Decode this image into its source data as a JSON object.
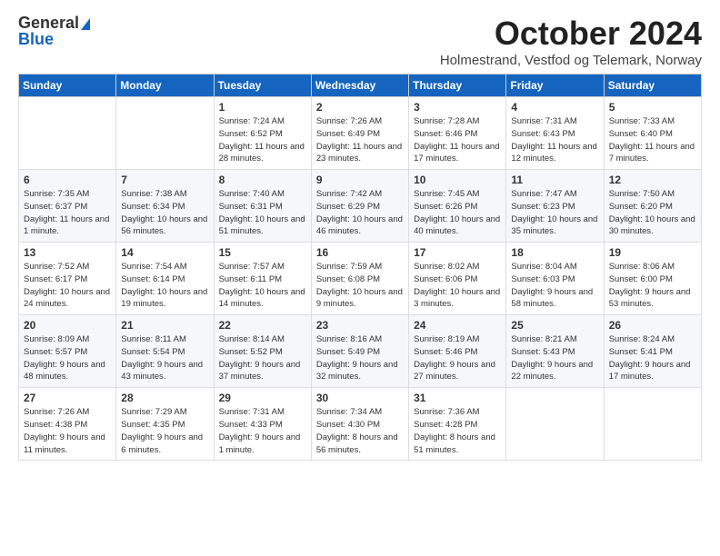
{
  "header": {
    "logo_line1": "General",
    "logo_line2": "Blue",
    "month": "October 2024",
    "location": "Holmestrand, Vestfod og Telemark, Norway"
  },
  "days_of_week": [
    "Sunday",
    "Monday",
    "Tuesday",
    "Wednesday",
    "Thursday",
    "Friday",
    "Saturday"
  ],
  "weeks": [
    [
      {
        "day": null,
        "text": ""
      },
      {
        "day": null,
        "text": ""
      },
      {
        "day": "1",
        "text": "Sunrise: 7:24 AM\nSunset: 6:52 PM\nDaylight: 11 hours and 28 minutes."
      },
      {
        "day": "2",
        "text": "Sunrise: 7:26 AM\nSunset: 6:49 PM\nDaylight: 11 hours and 23 minutes."
      },
      {
        "day": "3",
        "text": "Sunrise: 7:28 AM\nSunset: 6:46 PM\nDaylight: 11 hours and 17 minutes."
      },
      {
        "day": "4",
        "text": "Sunrise: 7:31 AM\nSunset: 6:43 PM\nDaylight: 11 hours and 12 minutes."
      },
      {
        "day": "5",
        "text": "Sunrise: 7:33 AM\nSunset: 6:40 PM\nDaylight: 11 hours and 7 minutes."
      }
    ],
    [
      {
        "day": "6",
        "text": "Sunrise: 7:35 AM\nSunset: 6:37 PM\nDaylight: 11 hours and 1 minute."
      },
      {
        "day": "7",
        "text": "Sunrise: 7:38 AM\nSunset: 6:34 PM\nDaylight: 10 hours and 56 minutes."
      },
      {
        "day": "8",
        "text": "Sunrise: 7:40 AM\nSunset: 6:31 PM\nDaylight: 10 hours and 51 minutes."
      },
      {
        "day": "9",
        "text": "Sunrise: 7:42 AM\nSunset: 6:29 PM\nDaylight: 10 hours and 46 minutes."
      },
      {
        "day": "10",
        "text": "Sunrise: 7:45 AM\nSunset: 6:26 PM\nDaylight: 10 hours and 40 minutes."
      },
      {
        "day": "11",
        "text": "Sunrise: 7:47 AM\nSunset: 6:23 PM\nDaylight: 10 hours and 35 minutes."
      },
      {
        "day": "12",
        "text": "Sunrise: 7:50 AM\nSunset: 6:20 PM\nDaylight: 10 hours and 30 minutes."
      }
    ],
    [
      {
        "day": "13",
        "text": "Sunrise: 7:52 AM\nSunset: 6:17 PM\nDaylight: 10 hours and 24 minutes."
      },
      {
        "day": "14",
        "text": "Sunrise: 7:54 AM\nSunset: 6:14 PM\nDaylight: 10 hours and 19 minutes."
      },
      {
        "day": "15",
        "text": "Sunrise: 7:57 AM\nSunset: 6:11 PM\nDaylight: 10 hours and 14 minutes."
      },
      {
        "day": "16",
        "text": "Sunrise: 7:59 AM\nSunset: 6:08 PM\nDaylight: 10 hours and 9 minutes."
      },
      {
        "day": "17",
        "text": "Sunrise: 8:02 AM\nSunset: 6:06 PM\nDaylight: 10 hours and 3 minutes."
      },
      {
        "day": "18",
        "text": "Sunrise: 8:04 AM\nSunset: 6:03 PM\nDaylight: 9 hours and 58 minutes."
      },
      {
        "day": "19",
        "text": "Sunrise: 8:06 AM\nSunset: 6:00 PM\nDaylight: 9 hours and 53 minutes."
      }
    ],
    [
      {
        "day": "20",
        "text": "Sunrise: 8:09 AM\nSunset: 5:57 PM\nDaylight: 9 hours and 48 minutes."
      },
      {
        "day": "21",
        "text": "Sunrise: 8:11 AM\nSunset: 5:54 PM\nDaylight: 9 hours and 43 minutes."
      },
      {
        "day": "22",
        "text": "Sunrise: 8:14 AM\nSunset: 5:52 PM\nDaylight: 9 hours and 37 minutes."
      },
      {
        "day": "23",
        "text": "Sunrise: 8:16 AM\nSunset: 5:49 PM\nDaylight: 9 hours and 32 minutes."
      },
      {
        "day": "24",
        "text": "Sunrise: 8:19 AM\nSunset: 5:46 PM\nDaylight: 9 hours and 27 minutes."
      },
      {
        "day": "25",
        "text": "Sunrise: 8:21 AM\nSunset: 5:43 PM\nDaylight: 9 hours and 22 minutes."
      },
      {
        "day": "26",
        "text": "Sunrise: 8:24 AM\nSunset: 5:41 PM\nDaylight: 9 hours and 17 minutes."
      }
    ],
    [
      {
        "day": "27",
        "text": "Sunrise: 7:26 AM\nSunset: 4:38 PM\nDaylight: 9 hours and 11 minutes."
      },
      {
        "day": "28",
        "text": "Sunrise: 7:29 AM\nSunset: 4:35 PM\nDaylight: 9 hours and 6 minutes."
      },
      {
        "day": "29",
        "text": "Sunrise: 7:31 AM\nSunset: 4:33 PM\nDaylight: 9 hours and 1 minute."
      },
      {
        "day": "30",
        "text": "Sunrise: 7:34 AM\nSunset: 4:30 PM\nDaylight: 8 hours and 56 minutes."
      },
      {
        "day": "31",
        "text": "Sunrise: 7:36 AM\nSunset: 4:28 PM\nDaylight: 8 hours and 51 minutes."
      },
      {
        "day": null,
        "text": ""
      },
      {
        "day": null,
        "text": ""
      }
    ]
  ]
}
